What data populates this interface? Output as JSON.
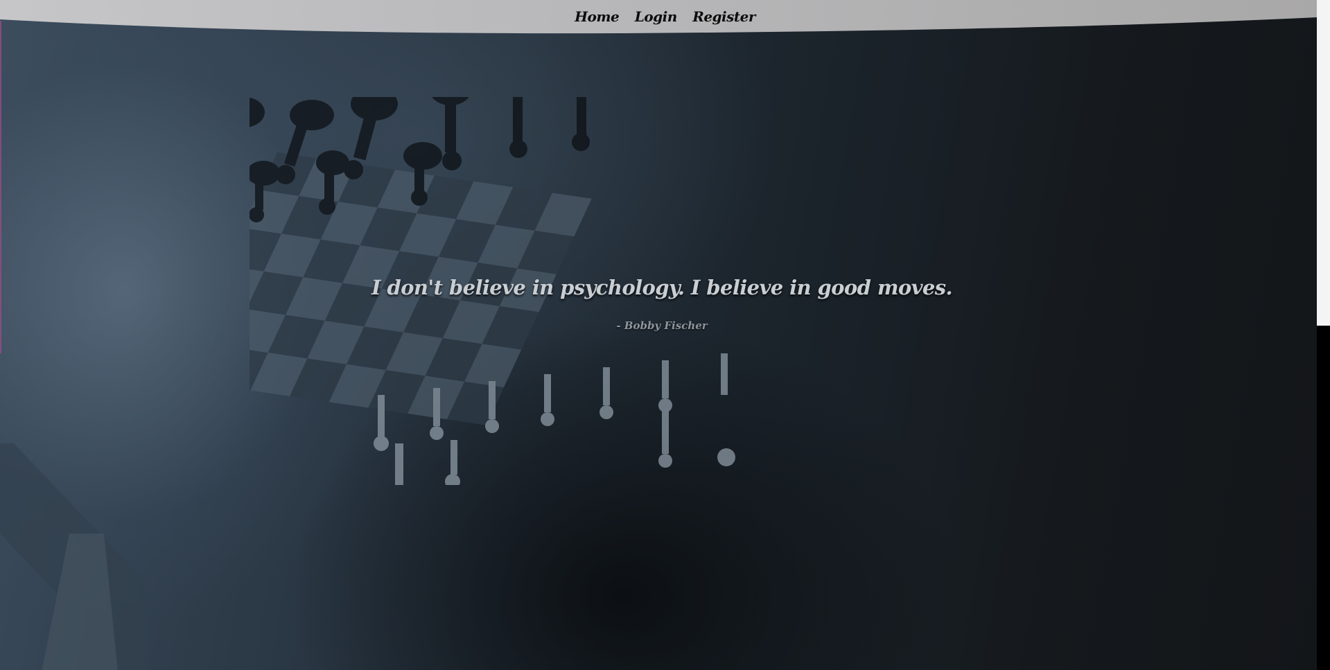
{
  "nav": {
    "items": [
      {
        "label": "Home"
      },
      {
        "label": "Login"
      },
      {
        "label": "Register"
      }
    ]
  },
  "hero": {
    "quote": "I don't believe in psychology. I believe in good moves.",
    "author": "- Bobby Fischer"
  },
  "colors": {
    "navbar": "#b9b9bb",
    "nav_text": "#0c0c0c",
    "quote_text": "#c9ced3",
    "author_text": "#8e969d",
    "background_dark": "#14191d"
  }
}
